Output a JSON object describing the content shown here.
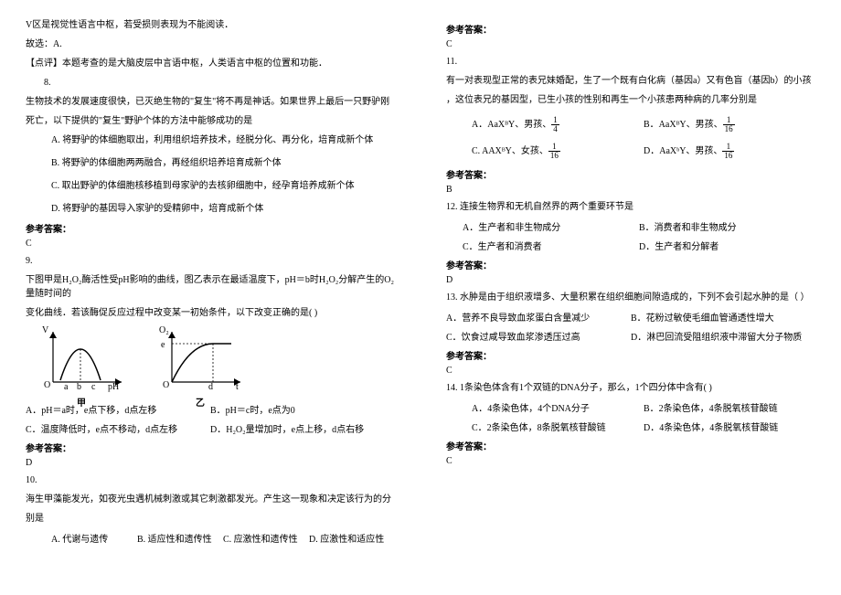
{
  "q7tail": {
    "l1": "V区是视觉性语言中枢，若受损则表现为不能阅读．",
    "l2": "故选：A.",
    "l3": "【点评】本题考查的是大脑皮层中言语中枢，人类语言中枢的位置和功能．"
  },
  "q8": {
    "num": "8.",
    "stem1": "生物技术的发展速度很快，已灭绝生物的\"复生\"将不再是神话。如果世界上最后一只野驴刚",
    "stem2": "死亡，以下提供的\"复生\"野驴个体的方法中能够成功的是",
    "a": "A. 将野驴的体细胞取出，利用组织培养技术，经脱分化、再分化，培育成新个体",
    "b": "B. 将野驴的体细胞两两融合，再经组织培养培育成新个体",
    "c": "C. 取出野驴的体细胞核移植到母家驴的去核卵细胞中，经孕育培养成新个体",
    "d": "D. 将野驴的基因导入家驴的受精卵中，培育成新个体",
    "anslabel": "参考答案：",
    "ans": "C"
  },
  "q9": {
    "num": "9.",
    "stem1": "下图甲是H₂O₂酶活性受pH影响的曲线，图乙表示在最适温度下，pH＝b时H₂O₂分解产生的O₂量随时间的",
    "stem2": "变化曲线．若该酶促反应过程中改变某一初始条件，以下改变正确的是(    )",
    "axisV": "V",
    "axisO": "O",
    "axisA": "a",
    "axisB": "b",
    "axisC": "c",
    "axisPH": "pH",
    "axisO2": "O₂",
    "axisE": "e",
    "axisD": "d",
    "axisT": "t",
    "labJia": "甲",
    "labYi": "乙",
    "a": "A．pH＝a时，e点下移，d点左移",
    "b": "B．pH＝c时，e点为0",
    "c": "C．温度降低时，e点不移动，d点左移",
    "d": "D．H₂O₂量增加时，e点上移，d点右移",
    "anslabel": "参考答案：",
    "ans": "D"
  },
  "q10": {
    "num": "10.",
    "stem1": "海生甲藻能发光，如夜光虫遇机械刺激或其它刺激都发光。产生这一现象和决定该行为的分",
    "stem2": "别是",
    "a": "A. 代谢与遗传",
    "b": "B. 适应性和遗传性",
    "c": "C. 应激性和遗传性",
    "d": "D. 应激性和适应性",
    "anslabel": "参考答案：",
    "ans": "C"
  },
  "q11": {
    "num": "11.",
    "stem1": "有一对表现型正常的表兄妹婚配，生了一个既有白化病（基因a）又有色盲（基因b）的小孩",
    "stem2": "，这位表兄的基因型，已生小孩的性别和再生一个小孩患两种病的几率分别是",
    "aPre": "A．AaXᴮY、男孩、",
    "bPre": "B．AaXᴮY、男孩、",
    "cPre": "C. AAXᴮY、女孩、",
    "dPre": "D．AaXᵇY、男孩、",
    "fa": {
      "n": "1",
      "d": "4"
    },
    "fb": {
      "n": "1",
      "d": "16"
    },
    "fc": {
      "n": "1",
      "d": "16"
    },
    "fd": {
      "n": "1",
      "d": "16"
    },
    "anslabel": "参考答案：",
    "ans": "B"
  },
  "q12": {
    "num": "12. ",
    "stem": "连接生物界和无机自然界的两个重要环节是",
    "a": "A．生产者和非生物成分",
    "b": "B．消费者和非生物成分",
    "c": "C．生产者和消费者",
    "d": "D．生产者和分解者",
    "anslabel": "参考答案：",
    "ans": "D"
  },
  "q13": {
    "num": "13. ",
    "stem": "水肿是由于组织液增多、大量积累在组织细胞间隙造成的，下列不会引起水肿的是（    ）",
    "a": "A．营养不良导致血浆蛋白含量减少",
    "b": "B．花粉过敏使毛细血管通透性增大",
    "c": "C．饮食过咸导致血浆渗透压过高",
    "d": "D．淋巴回流受阻组织液中滞留大分子物质",
    "anslabel": "参考答案：",
    "ans": "C"
  },
  "q14": {
    "num": "14. ",
    "stem": "1条染色体含有1个双链的DNA分子，那么，1个四分体中含有(    )",
    "a": "A．4条染色体，4个DNA分子",
    "b": "B．2条染色体，4条脱氧核苷酸链",
    "c": "C．2条染色体，8条脱氧核苷酸链",
    "d": "D．4条染色体，4条脱氧核苷酸链",
    "anslabel": "参考答案：",
    "ans": "C"
  }
}
